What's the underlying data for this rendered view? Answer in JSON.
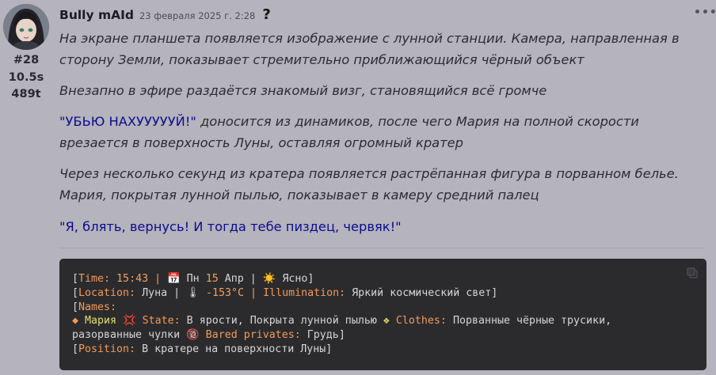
{
  "user": {
    "name": "Bully mAId",
    "timestamp": "23 февраля 2025 г. 2:28",
    "help_glyph": "?",
    "menu_glyph": "•••"
  },
  "meta": {
    "id": "#28",
    "time": "10.5s",
    "tokens": "489t"
  },
  "message": {
    "p1_line1": "На экране планшета появляется изображение с лунной станции. Камера, направленная в",
    "p1_line2": "сторону Земли, показывает стремительно приближающийся чёрный объект",
    "p2": "Внезапно в эфире раздаётся знакомый визг, становящийся всё громче",
    "p3_speech": "\"УБЬЮ НАХУУУУУЙ!\"",
    "p3_rest": " доносится из динамиков, после чего Мария на полной скорости",
    "p3_line2": "врезается в поверхность Луны, оставляя огромный кратер",
    "p4_line1": "Через несколько секунд из кратера появляется растрёпанная фигура в порванном белье.",
    "p4_line2": "Мария, покрытая лунной пылью, показывает в камеру средний палец",
    "p5_speech": "\"Я, блять, вернусь! И тогда тебе пиздец, червяк!\""
  },
  "status": {
    "time_key": "Time:",
    "time_val": " 15:43 | ",
    "cal_glyph": "📅",
    "day": " Пн ",
    "date_num": "15",
    "month": " Апр | ",
    "sun_glyph": "☀️",
    "weather": " Ясно",
    "location_key": "Location:",
    "location_val": " Луна | ",
    "thermo_glyph": "🌡",
    "temp": " -153°C | ",
    "illum_key": "Illumination:",
    "illum_val": " Яркий космический свет",
    "names_key": "Names:",
    "diamond_glyph": "◆",
    "char_name": " Мария ",
    "anger_glyph": "💢",
    "state_key": " State:",
    "state_val": " В ярости, Покрыта лунной пылью ",
    "sep_glyph": "❖",
    "clothes_key": " Clothes:",
    "clothes_val": " Порванные чёрные трусики,",
    "clothes_val2": "разорванные чулки ",
    "adult_glyph": "🔞",
    "bared_key": " Bared privates:",
    "bared_val": " Грудь",
    "position_key": "Position:",
    "position_val": " В кратере на поверхности Луны",
    "open_bracket": "[",
    "close_bracket": "]"
  },
  "colors": {
    "background": "#b5b3bb",
    "speech": "#0b0b8f",
    "code_bg": "#2b2b2d",
    "code_key": "#f29a5a",
    "code_name": "#e0e06a"
  },
  "icons": {
    "avatar": "avatar-image",
    "copy": "copy-icon",
    "menu": "more-dots-icon",
    "help": "question-mark-icon"
  }
}
